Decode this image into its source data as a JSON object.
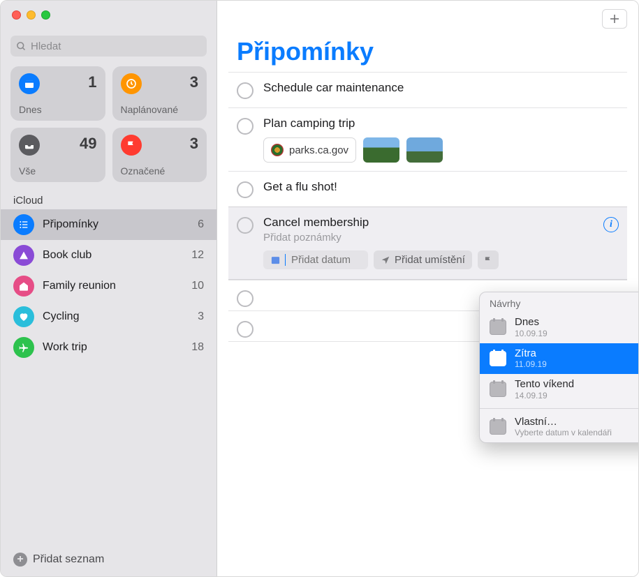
{
  "window": {
    "search_placeholder": "Hledat"
  },
  "smart": {
    "today": {
      "label": "Dnes",
      "count": "1"
    },
    "scheduled": {
      "label": "Naplánované",
      "count": "3"
    },
    "all": {
      "label": "Vše",
      "count": "49"
    },
    "flagged": {
      "label": "Označené",
      "count": "3"
    }
  },
  "section_icloud": "iCloud",
  "lists": [
    {
      "name": "Připomínky",
      "count": "6",
      "color": "#0a7cff",
      "selected": true,
      "icon": "list"
    },
    {
      "name": "Book club",
      "count": "12",
      "color": "#8a4bd6",
      "selected": false,
      "icon": "tent"
    },
    {
      "name": "Family reunion",
      "count": "10",
      "color": "#e64d86",
      "selected": false,
      "icon": "home"
    },
    {
      "name": "Cycling",
      "count": "3",
      "color": "#2abedb",
      "selected": false,
      "icon": "heart"
    },
    {
      "name": "Work trip",
      "count": "18",
      "color": "#2dc24d",
      "selected": false,
      "icon": "plane"
    }
  ],
  "add_list_label": "Přidat seznam",
  "main": {
    "title": "Připomínky",
    "items": [
      {
        "title": "Schedule car maintenance"
      },
      {
        "title": "Plan camping trip",
        "link": "parks.ca.gov"
      },
      {
        "title": "Get a flu shot!"
      },
      {
        "title": "Cancel membership",
        "notes_placeholder": "Přidat poznámky",
        "add_date": "Přidat datum",
        "add_location": "Přidat umístění"
      }
    ]
  },
  "popover": {
    "header": "Návrhy",
    "suggestions": [
      {
        "title": "Dnes",
        "date": "10.09.19",
        "selected": false
      },
      {
        "title": "Zítra",
        "date": "11.09.19",
        "selected": true
      },
      {
        "title": "Tento víkend",
        "date": "14.09.19",
        "selected": false
      }
    ],
    "custom": {
      "title": "Vlastní…",
      "subtitle": "Vyberte datum v kalendáři"
    }
  }
}
